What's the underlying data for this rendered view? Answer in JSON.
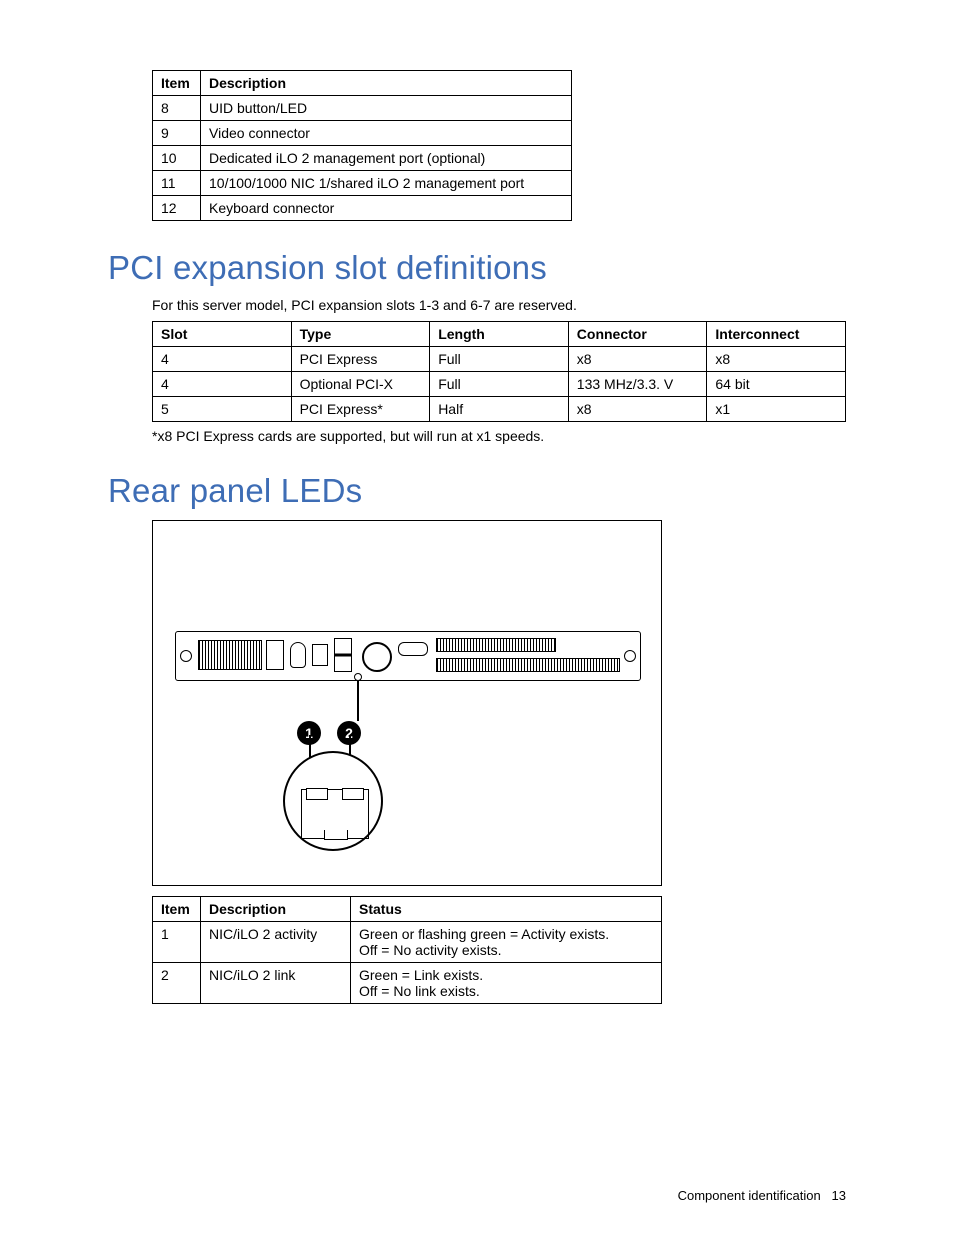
{
  "table_top": {
    "headers": [
      "Item",
      "Description"
    ],
    "rows": [
      [
        "8",
        "UID button/LED"
      ],
      [
        "9",
        "Video connector"
      ],
      [
        "10",
        "Dedicated iLO 2 management port (optional)"
      ],
      [
        "11",
        "10/100/1000 NIC 1/shared iLO 2 management port"
      ],
      [
        "12",
        "Keyboard connector"
      ]
    ]
  },
  "section_pci": {
    "heading": "PCI expansion slot definitions",
    "intro": "For this server model, PCI expansion slots 1-3 and 6-7 are reserved.",
    "headers": [
      "Slot",
      "Type",
      "Length",
      "Connector",
      "Interconnect"
    ],
    "rows": [
      [
        "4",
        "PCI Express",
        "Full",
        "x8",
        "x8"
      ],
      [
        "4",
        "Optional PCI-X",
        "Full",
        "133 MHz/3.3. V",
        "64 bit"
      ],
      [
        "5",
        "PCI Express*",
        "Half",
        "x8",
        "x1"
      ]
    ],
    "footnote": "*x8 PCI Express cards are supported, but will run at x1 speeds."
  },
  "section_leds": {
    "heading": "Rear panel LEDs",
    "badge_labels": [
      "1",
      "2"
    ],
    "headers": [
      "Item",
      "Description",
      "Status"
    ],
    "rows": [
      {
        "item": "1",
        "desc": "NIC/iLO 2 activity",
        "status": [
          "Green or flashing green = Activity exists.",
          "Off = No activity exists."
        ]
      },
      {
        "item": "2",
        "desc": "NIC/iLO 2 link",
        "status": [
          "Green = Link exists.",
          "Off = No link exists."
        ]
      }
    ]
  },
  "footer": {
    "section": "Component identification",
    "page": "13"
  }
}
